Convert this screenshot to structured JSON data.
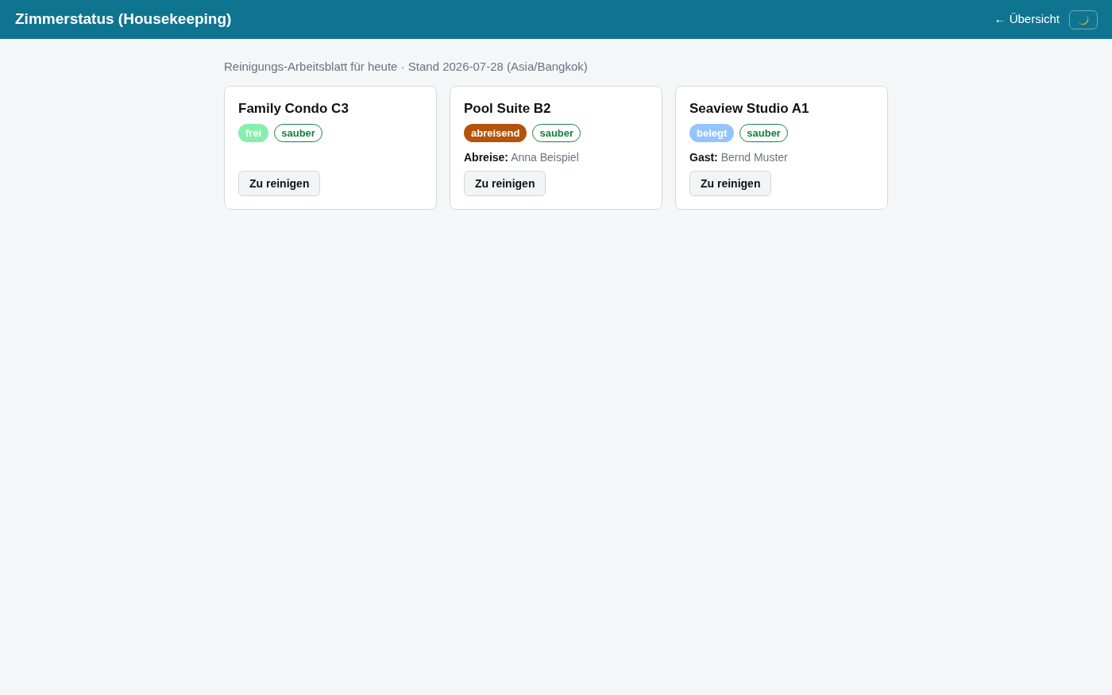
{
  "header": {
    "title": "Zimmerstatus (Housekeeping)",
    "back_link": "← Übersicht"
  },
  "subtitle": "Reinigungs-Arbeitsblatt für heute · Stand 2026-07-28 (Asia/Bangkok)",
  "rooms": [
    {
      "name": "Family Condo C3",
      "occupancy": {
        "label": "frei",
        "color": "#86efac"
      },
      "cleanliness": {
        "label": "sauber",
        "color": "#15803d"
      },
      "button": "Zu reinigen"
    },
    {
      "name": "Pool Suite B2",
      "occupancy": {
        "label": "abreisend",
        "color": "#b45309"
      },
      "cleanliness": {
        "label": "sauber",
        "color": "#15803d"
      },
      "detail": {
        "label": "Abreise:",
        "value": "Anna Beispiel"
      },
      "button": "Zu reinigen"
    },
    {
      "name": "Seaview Studio A1",
      "occupancy": {
        "label": "belegt",
        "color": "#93c5fd"
      },
      "cleanliness": {
        "label": "sauber",
        "color": "#15803d"
      },
      "detail": {
        "label": "Gast:",
        "value": "Bernd Muster"
      },
      "button": "Zu reinigen"
    }
  ]
}
